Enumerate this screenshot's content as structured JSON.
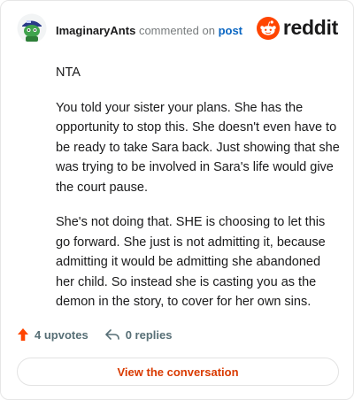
{
  "comment": {
    "author": "ImaginaryAnts",
    "verb": "commented on",
    "post_link": "post",
    "paragraphs": [
      "NTA",
      "You told your sister your plans. She has the opportunity to stop this. She doesn't even have to be ready to take Sara back. Just showing that she was trying to be involved in Sara's life would give the court pause.",
      "She's not doing that. SHE is choosing to let this go forward. She just is not admitting it, because admitting it would be admitting she abandoned her child. So instead she is casting you as the demon in the story, to cover for her own sins."
    ]
  },
  "brand": {
    "name": "reddit",
    "color": "#ff4500"
  },
  "actions": {
    "upvotes_label": "4 upvotes",
    "replies_label": "0 replies"
  },
  "cta": {
    "label": "View the conversation",
    "color": "#d93a00"
  },
  "icons": {
    "avatar": "snoo-avatar-icon",
    "brand": "reddit-logo-icon",
    "upvote": "upvote-arrow-icon",
    "reply": "reply-arrow-icon"
  }
}
